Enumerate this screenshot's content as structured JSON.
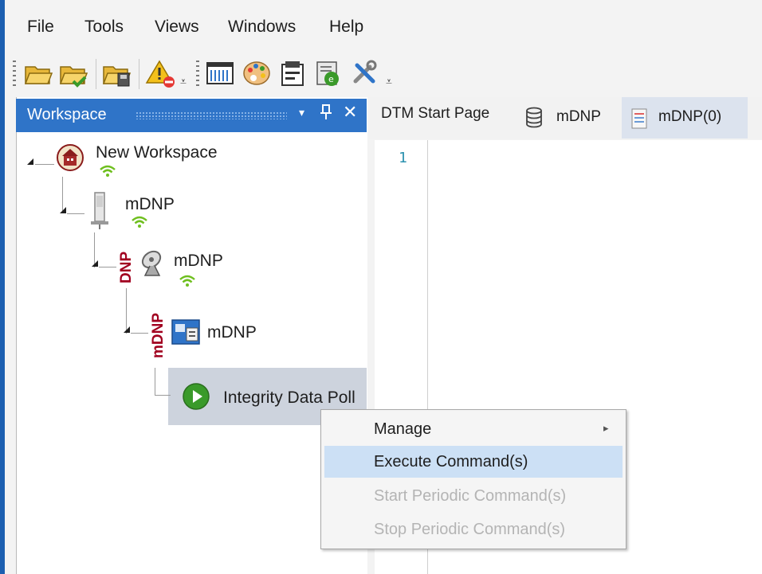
{
  "menu": {
    "items": [
      "File",
      "Tools",
      "Views",
      "Windows",
      "Help"
    ]
  },
  "toolbar": {
    "icons": [
      "open-folder-icon",
      "save-folder-icon",
      "save-device-icon",
      "warning-remove-icon",
      "grid-window-icon",
      "palette-icon",
      "clipboard-icon",
      "device-report-icon",
      "tools-icon"
    ]
  },
  "workspace": {
    "title": "Workspace",
    "dropdown_glyph": "▾",
    "pin_glyph": "⊓",
    "close_glyph": "✕",
    "tree": {
      "root": "New Workspace",
      "device": "mDNP",
      "channel": "mDNP",
      "channel_tag": "DNP",
      "master": "mDNP",
      "master_tag": "mDNP",
      "command": "Integrity Data Poll"
    }
  },
  "tabs": [
    {
      "label": "DTM Start Page"
    },
    {
      "label": "mDNP"
    },
    {
      "label": "mDNP(0)"
    }
  ],
  "editor": {
    "line_number": "1"
  },
  "context_menu": {
    "items": [
      {
        "label": "Manage",
        "enabled": true,
        "has_submenu": true
      },
      {
        "label": "Execute Command(s)",
        "enabled": true,
        "highlighted": true
      },
      {
        "label": "Start Periodic Command(s)",
        "enabled": false
      },
      {
        "label": "Stop Periodic Command(s)",
        "enabled": false
      }
    ],
    "submenu_glyph": "▸"
  },
  "colors": {
    "workspace_header": "#2f74c8",
    "selected_row": "#cdd3dd",
    "menu_highlight": "#cce0f5",
    "dnp_red": "#a1001f",
    "wifi_green": "#6fbf1f"
  }
}
